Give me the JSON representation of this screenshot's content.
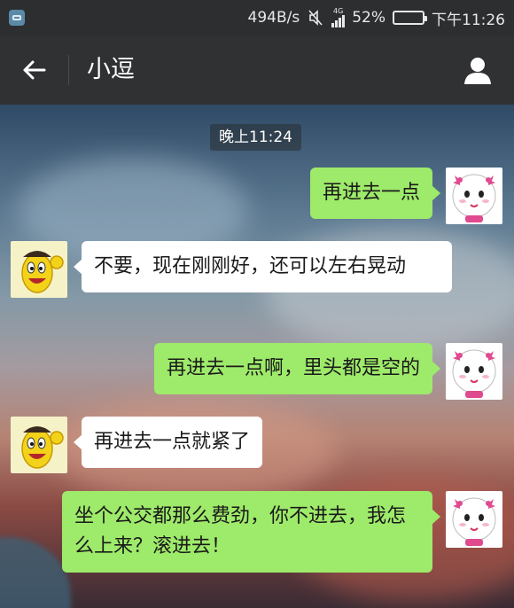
{
  "status_bar": {
    "network_speed": "494B/s",
    "network_type": "4G",
    "battery_percent": "52%",
    "battery_level": 0.52,
    "time": "下午11:26"
  },
  "title_bar": {
    "chat_name": "小逗"
  },
  "conversation": {
    "timestamp": "晚上11:24",
    "messages": [
      {
        "side": "right",
        "sender": "girl",
        "text": "再进去一点"
      },
      {
        "side": "left",
        "sender": "bean",
        "text": "不要，现在刚刚好，还可以左右晃动"
      },
      {
        "side": "right",
        "sender": "girl",
        "text": "再进去一点啊，里头都是空的"
      },
      {
        "side": "left",
        "sender": "bean",
        "text": "再进去一点就紧了"
      },
      {
        "side": "right",
        "sender": "girl",
        "text": "坐个公交都那么费劲，你不进去，我怎么上来？滚进去！"
      }
    ]
  },
  "colors": {
    "outgoing_bubble": "#9eea6a",
    "incoming_bubble": "#ffffff",
    "header": "#303133"
  }
}
